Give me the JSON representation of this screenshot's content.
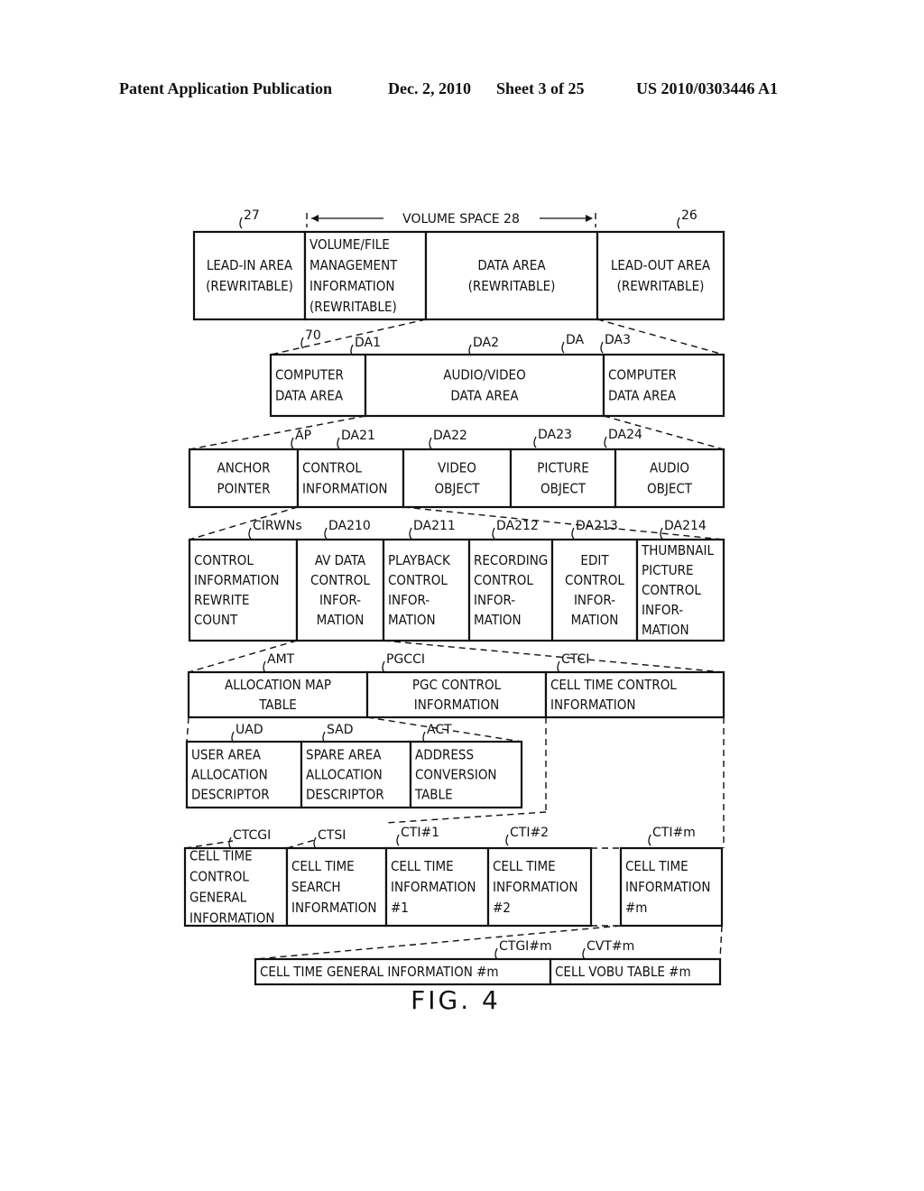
{
  "header": {
    "publication": "Patent Application Publication",
    "date": "Dec. 2, 2010",
    "sheet": "Sheet 3 of 25",
    "number": "US 2010/0303446 A1"
  },
  "figure_label": "FIG. 4",
  "volume_space_label": "VOLUME SPACE 28",
  "rows": [
    {
      "id": "disc",
      "boxes": [
        {
          "ref": "27",
          "lines": [
            "LEAD-IN AREA",
            "(REWRITABLE)"
          ]
        },
        {
          "ref": "70",
          "lines": [
            "VOLUME/FILE",
            "MANAGEMENT",
            "INFORMATION",
            "(REWRITABLE)"
          ]
        },
        {
          "ref": "DA",
          "lines": [
            "DATA AREA",
            "(REWRITABLE)"
          ]
        },
        {
          "ref": "26",
          "lines": [
            "LEAD-OUT AREA",
            "(REWRITABLE)"
          ]
        }
      ]
    },
    {
      "id": "data-area",
      "boxes": [
        {
          "ref": "DA1",
          "lines": [
            "COMPUTER",
            "DATA AREA"
          ]
        },
        {
          "ref": "DA2",
          "lines": [
            "AUDIO/VIDEO",
            "DATA AREA"
          ]
        },
        {
          "ref": "DA3",
          "lines": [
            "COMPUTER",
            "DATA AREA"
          ]
        }
      ]
    },
    {
      "id": "av-data-area",
      "boxes": [
        {
          "ref": "AP",
          "lines": [
            "ANCHOR",
            "POINTER"
          ]
        },
        {
          "ref": "DA21",
          "lines": [
            "CONTROL",
            "INFORMATION"
          ]
        },
        {
          "ref": "DA22",
          "lines": [
            "VIDEO",
            "OBJECT"
          ]
        },
        {
          "ref": "DA23",
          "lines": [
            "PICTURE",
            "OBJECT"
          ]
        },
        {
          "ref": "DA24",
          "lines": [
            "AUDIO",
            "OBJECT"
          ]
        }
      ]
    },
    {
      "id": "control-information",
      "boxes": [
        {
          "ref": "CIRWNs",
          "lines": [
            "CONTROL",
            "INFORMATION",
            "REWRITE",
            "COUNT"
          ]
        },
        {
          "ref": "DA210",
          "lines": [
            "AV DATA",
            "CONTROL",
            "INFOR-",
            "MATION"
          ]
        },
        {
          "ref": "DA211",
          "lines": [
            "PLAYBACK",
            "CONTROL",
            "INFOR-",
            "MATION"
          ]
        },
        {
          "ref": "DA212",
          "lines": [
            "RECORDING",
            "CONTROL",
            "INFOR-",
            "MATION"
          ]
        },
        {
          "ref": "DA213",
          "lines": [
            "EDIT",
            "CONTROL",
            "INFOR-",
            "MATION"
          ]
        },
        {
          "ref": "DA214",
          "lines": [
            "THUMBNAIL",
            "PICTURE",
            "CONTROL",
            "INFOR-",
            "MATION"
          ]
        }
      ]
    },
    {
      "id": "av-data-control",
      "boxes": [
        {
          "ref": "AMT",
          "lines": [
            "ALLOCATION MAP",
            "TABLE"
          ]
        },
        {
          "ref": "PGCCI",
          "lines": [
            "PGC CONTROL",
            "INFORMATION"
          ]
        },
        {
          "ref": "CTCI",
          "lines": [
            "CELL TIME CONTROL",
            "INFORMATION"
          ]
        }
      ]
    },
    {
      "id": "allocation-map",
      "boxes": [
        {
          "ref": "UAD",
          "lines": [
            "USER AREA",
            "ALLOCATION",
            "DESCRIPTOR"
          ]
        },
        {
          "ref": "SAD",
          "lines": [
            "SPARE AREA",
            "ALLOCATION",
            "DESCRIPTOR"
          ]
        },
        {
          "ref": "ACT",
          "lines": [
            "ADDRESS",
            "CONVERSION",
            "TABLE"
          ]
        }
      ]
    },
    {
      "id": "cell-time-control",
      "boxes": [
        {
          "ref": "CTCGI",
          "lines": [
            "CELL TIME",
            "CONTROL",
            "GENERAL",
            "INFORMATION"
          ]
        },
        {
          "ref": "CTSI",
          "lines": [
            "CELL TIME",
            "SEARCH",
            "INFORMATION"
          ]
        },
        {
          "ref": "CTI#1",
          "lines": [
            "CELL TIME",
            "INFORMATION",
            "#1"
          ]
        },
        {
          "ref": "CTI#2",
          "lines": [
            "CELL TIME",
            "INFORMATION",
            "#2"
          ]
        },
        {
          "ref": "CTI#m",
          "lines": [
            "CELL TIME",
            "INFORMATION",
            "#m"
          ]
        }
      ]
    },
    {
      "id": "cell-time-information",
      "boxes": [
        {
          "ref": "CTGI#m",
          "lines": [
            "CELL TIME GENERAL INFORMATION #m"
          ]
        },
        {
          "ref": "CVT#m",
          "lines": [
            "CELL VOBU TABLE #m"
          ]
        }
      ]
    }
  ]
}
